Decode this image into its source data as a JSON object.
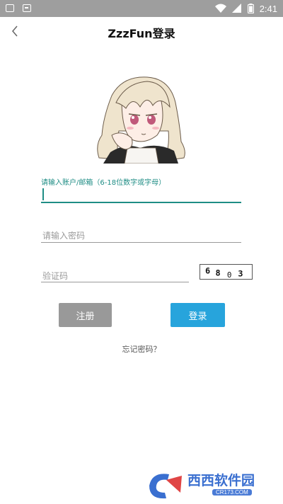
{
  "status_bar": {
    "time": "2:41",
    "icons": [
      "notification-icon",
      "sim-icon",
      "wifi-icon",
      "signal-icon",
      "battery-icon"
    ]
  },
  "app_bar": {
    "title": "ZzzFun登录",
    "back_icon": "chevron-left-icon"
  },
  "form": {
    "account_label": "请输入账户/邮箱（6-18位数字或字母）",
    "password_placeholder": "请输入密码",
    "captcha_placeholder": "验证码",
    "captcha_chars": [
      "6",
      "8",
      "0",
      "3"
    ]
  },
  "buttons": {
    "register_label": "注册",
    "login_label": "登录"
  },
  "forgot_label": "忘记密码？",
  "watermark": {
    "name": "西西软件园",
    "url": "CR173.COM"
  },
  "colors": {
    "accent": "#1f8d85",
    "login_button": "#27a4dc",
    "register_button": "#999999",
    "status_bar": "#9e9e9e"
  }
}
